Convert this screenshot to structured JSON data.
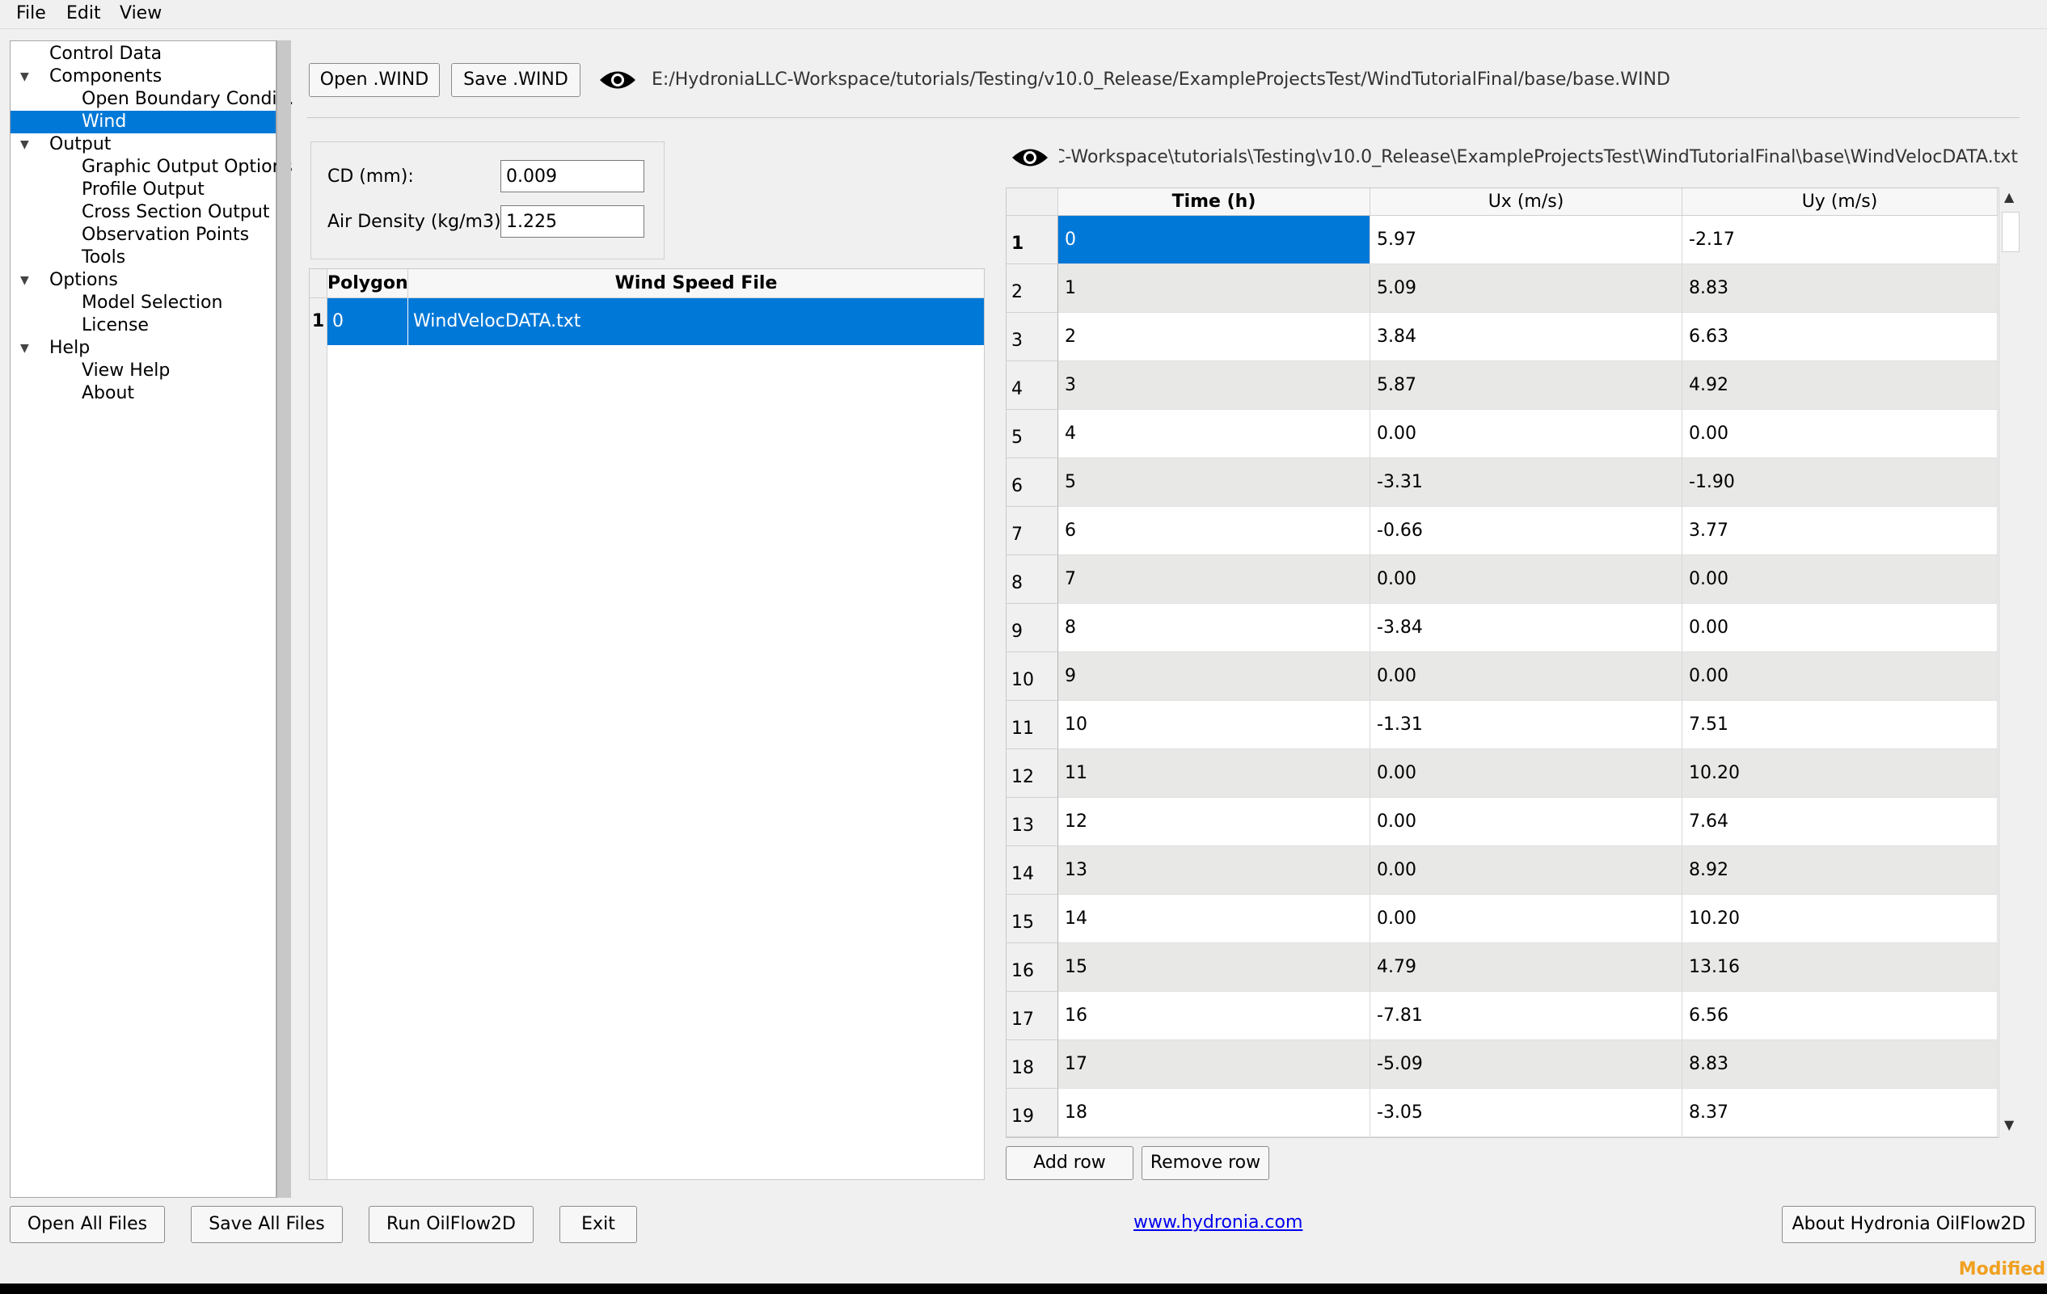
{
  "menu": [
    "File",
    "Edit",
    "View"
  ],
  "tree": [
    {
      "label": "Control Data",
      "level": 1,
      "expand": false,
      "selected": false
    },
    {
      "label": "Components",
      "level": 1,
      "expand": true,
      "selected": false
    },
    {
      "label": "Open Boundary Condi...",
      "level": 2,
      "expand": false,
      "selected": false
    },
    {
      "label": "Wind",
      "level": 2,
      "expand": false,
      "selected": true
    },
    {
      "label": "Output",
      "level": 1,
      "expand": true,
      "selected": false
    },
    {
      "label": "Graphic Output Options",
      "level": 2,
      "expand": false,
      "selected": false
    },
    {
      "label": "Profile Output",
      "level": 2,
      "expand": false,
      "selected": false
    },
    {
      "label": "Cross Section Output",
      "level": 2,
      "expand": false,
      "selected": false
    },
    {
      "label": "Observation Points",
      "level": 2,
      "expand": false,
      "selected": false
    },
    {
      "label": "Tools",
      "level": 2,
      "expand": false,
      "selected": false
    },
    {
      "label": "Options",
      "level": 1,
      "expand": true,
      "selected": false
    },
    {
      "label": "Model Selection",
      "level": 2,
      "expand": false,
      "selected": false
    },
    {
      "label": "License",
      "level": 2,
      "expand": false,
      "selected": false
    },
    {
      "label": "Help",
      "level": 1,
      "expand": true,
      "selected": false
    },
    {
      "label": "View Help",
      "level": 2,
      "expand": false,
      "selected": false
    },
    {
      "label": "About",
      "level": 2,
      "expand": false,
      "selected": false
    }
  ],
  "toolbar": {
    "open_label": "Open .WIND",
    "save_label": "Save .WIND",
    "wind_file_path": "E:/HydroniaLLC-Workspace/tutorials/Testing/v10.0_Release/ExampleProjectsTest/WindTutorialFinal/base/base.WIND"
  },
  "params": {
    "cd_label": "CD (mm):",
    "cd_value": "0.009",
    "air_label": "Air Density (kg/m3):",
    "air_value": "1.225"
  },
  "poly_table": {
    "headers": [
      "Polygon",
      "Wind Speed File"
    ],
    "rows": [
      {
        "num": "1",
        "polygon": "0",
        "file": "WindVelocDATA.txt"
      }
    ]
  },
  "data_file_path": "HydroniaLLC-Workspace\\tutorials\\Testing\\v10.0_Release\\ExampleProjectsTest\\WindTutorialFinal\\base\\WindVelocDATA.txt",
  "wind_table": {
    "headers": [
      "Time (h)",
      "Ux (m/s)",
      "Uy (m/s)"
    ],
    "rows": [
      [
        "1",
        "0",
        "5.97",
        "-2.17"
      ],
      [
        "2",
        "1",
        "5.09",
        "8.83"
      ],
      [
        "3",
        "2",
        "3.84",
        "6.63"
      ],
      [
        "4",
        "3",
        "5.87",
        "4.92"
      ],
      [
        "5",
        "4",
        "0.00",
        "0.00"
      ],
      [
        "6",
        "5",
        "-3.31",
        "-1.90"
      ],
      [
        "7",
        "6",
        "-0.66",
        "3.77"
      ],
      [
        "8",
        "7",
        "0.00",
        "0.00"
      ],
      [
        "9",
        "8",
        "-3.84",
        "0.00"
      ],
      [
        "10",
        "9",
        "0.00",
        "0.00"
      ],
      [
        "11",
        "10",
        "-1.31",
        "7.51"
      ],
      [
        "12",
        "11",
        "0.00",
        "10.20"
      ],
      [
        "13",
        "12",
        "0.00",
        "7.64"
      ],
      [
        "14",
        "13",
        "0.00",
        "8.92"
      ],
      [
        "15",
        "14",
        "0.00",
        "10.20"
      ],
      [
        "16",
        "15",
        "4.79",
        "13.16"
      ],
      [
        "17",
        "16",
        "-7.81",
        "6.56"
      ],
      [
        "18",
        "17",
        "-5.09",
        "8.83"
      ],
      [
        "19",
        "18",
        "-3.05",
        "8.37"
      ]
    ]
  },
  "table_buttons": {
    "add": "Add row",
    "remove": "Remove row"
  },
  "bottom": {
    "open_all": "Open All Files",
    "save_all": "Save All Files",
    "run": "Run OilFlow2D",
    "exit": "Exit",
    "link": "www.hydronia.com",
    "about": "About Hydronia OilFlow2D",
    "status": "Modified"
  },
  "colors": {
    "selection": "#0078d7",
    "status": "#f0a020",
    "link": "#0000ee"
  }
}
